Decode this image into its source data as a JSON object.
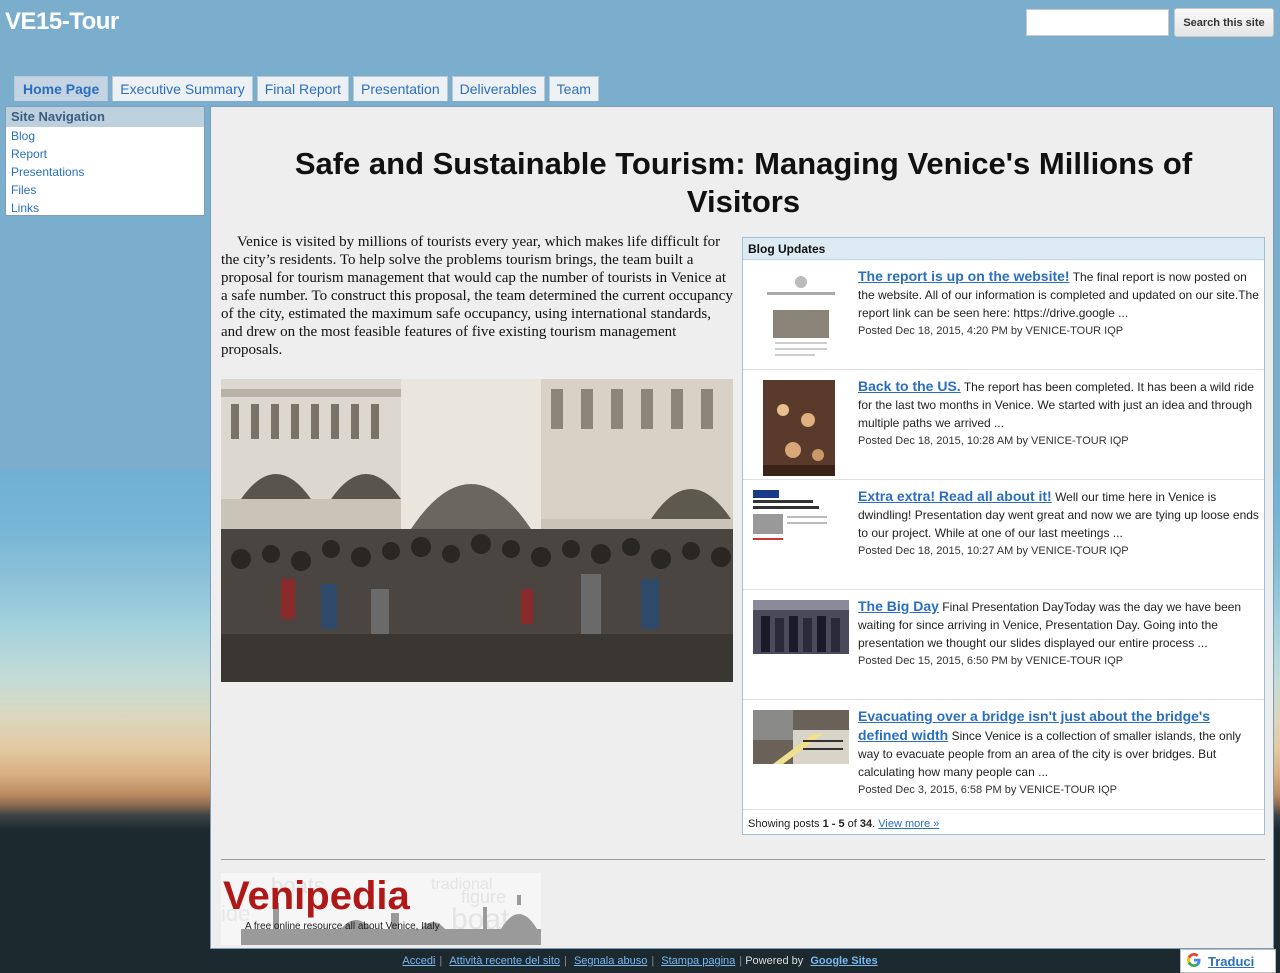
{
  "header": {
    "site_title": "VE15-Tour",
    "search_placeholder": "",
    "search_button": "Search this site"
  },
  "tabs": [
    {
      "label": "Home Page",
      "active": true
    },
    {
      "label": "Executive Summary"
    },
    {
      "label": "Final Report"
    },
    {
      "label": "Presentation"
    },
    {
      "label": "Deliverables"
    },
    {
      "label": "Team"
    }
  ],
  "sidebar": {
    "title": "Site Navigation",
    "items": [
      {
        "label": "Blog"
      },
      {
        "label": "Report"
      },
      {
        "label": "Presentations"
      },
      {
        "label": "Files"
      },
      {
        "label": "Links"
      }
    ]
  },
  "main": {
    "title": "Safe and Sustainable Tourism: Managing Venice's Millions of Visitors",
    "intro": "Venice is visited by millions of tourists every year, which makes life difficult for the city’s residents. To help solve the problems tourism brings, the team built a proposal for tourism management that would cap the number of tourists in Venice at a safe number. To construct this proposal, the team determined the current occupancy of the city, estimated the maximum safe occupancy, using international standards, and drew on the most feasible features of five existing tourism management proposals."
  },
  "blog": {
    "header": "Blog Updates",
    "posts": [
      {
        "title": "The report is up on the website!",
        "snippet": "The final report is now posted on the website. All of our information is completed and updated on our site.The report link can be seen here: https://drive.google ...",
        "meta": "Posted Dec 18, 2015, 4:20 PM by VENICE-TOUR IQP"
      },
      {
        "title": "Back to the US.",
        "snippet": "The report has been completed. It has been a wild ride for the last two months in Venice. We started with just an idea and through multiple paths we arrived ...",
        "meta": "Posted Dec 18, 2015, 10:28 AM by VENICE-TOUR IQP"
      },
      {
        "title": "Extra extra! Read all about it!",
        "snippet": "Well our time here in Venice is dwindling! Presentation day went great and now we are tying up loose ends to our project. While at one of our last meetings ...",
        "meta": "Posted Dec 18, 2015, 10:27 AM by VENICE-TOUR IQP"
      },
      {
        "title": "The Big Day",
        "snippet": "Final Presentation DayToday was the day we have been waiting for since arriving in Venice, Presentation Day. Going into the presentation we thought our slides displayed our entire process ...",
        "meta": "Posted Dec 15, 2015, 6:50 PM by VENICE-TOUR IQP"
      },
      {
        "title": "Evacuating over a bridge isn't just about the bridge's defined width",
        "snippet": "Since Venice is a collection of smaller islands, the only way to evacuate people from an area of the city is over bridges. But calculating how many people can ...",
        "meta": "Posted Dec 3, 2015, 6:58 PM by VENICE-TOUR IQP"
      }
    ],
    "footer_prefix": "Showing posts ",
    "footer_range": "1 - 5",
    "footer_mid": " of ",
    "footer_total": "34",
    "footer_suffix": ". ",
    "view_more": "View more »"
  },
  "logo": {
    "name": "Venipedia",
    "tagline": "A free online resource all about Venice, Italy"
  },
  "footer": {
    "links": [
      "Accedi",
      "Attività recente del sito",
      "Segnala abuso",
      "Stampa pagina"
    ],
    "powered_by": "Powered by",
    "google_sites": "Google Sites"
  },
  "translate": {
    "label": "Traduci"
  },
  "colors": {
    "link": "#2a6fbf",
    "accent_tab": "#c4d4e2",
    "logo_red": "#b01818"
  }
}
